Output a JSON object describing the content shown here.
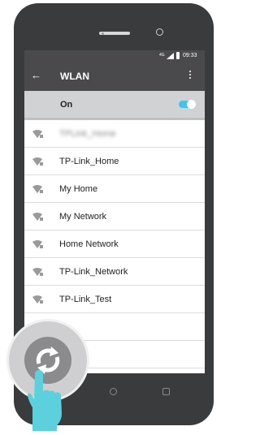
{
  "statusbar": {
    "network": "4G",
    "time": "09:33"
  },
  "appbar": {
    "title": "WLAN"
  },
  "toggle": {
    "label": "On",
    "state": "on",
    "accent": "#44c2ea"
  },
  "networks": [
    {
      "name": "TPLink_Home",
      "obscured": true
    },
    {
      "name": "TP-Link_Home"
    },
    {
      "name": "My Home"
    },
    {
      "name": "My Network"
    },
    {
      "name": "Home Network"
    },
    {
      "name": "TP-Link_Network"
    },
    {
      "name": "TP-Link_Test"
    },
    {
      "name": ""
    },
    {
      "name": ""
    }
  ],
  "icons": {
    "back": "arrow-left",
    "more": "vertical-dots",
    "wifi": "wifi-lock",
    "refresh": "refresh-arrows",
    "hand": "pointing-hand"
  }
}
